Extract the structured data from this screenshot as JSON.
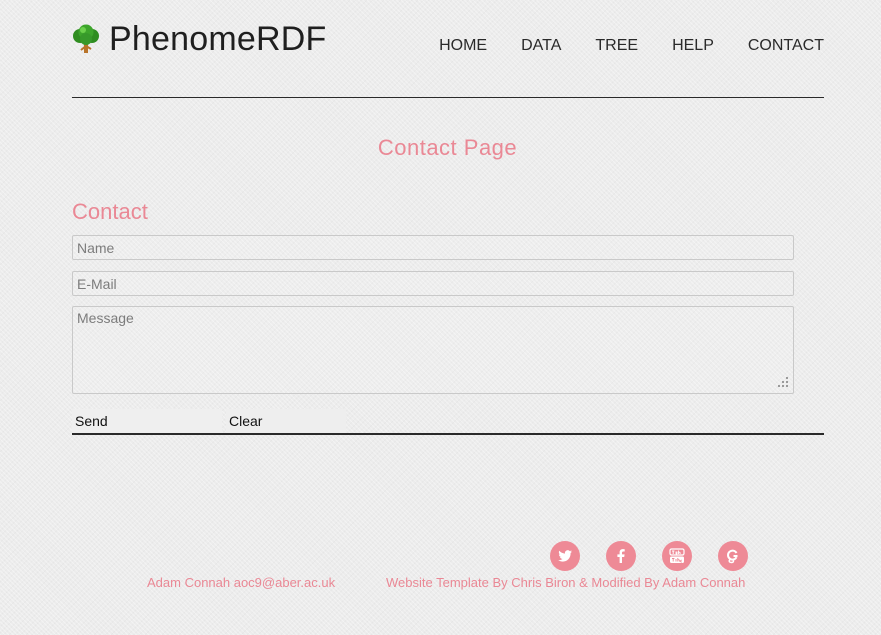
{
  "header": {
    "brand": "PhenomeRDF",
    "logo_icon": "tree-icon",
    "nav": [
      {
        "label": "HOME"
      },
      {
        "label": "DATA"
      },
      {
        "label": "TREE"
      },
      {
        "label": "HELP"
      },
      {
        "label": "CONTACT"
      }
    ]
  },
  "page": {
    "title": "Contact Page"
  },
  "form": {
    "heading": "Contact",
    "name_placeholder": "Name",
    "email_placeholder": "E-Mail",
    "message_placeholder": "Message",
    "send_label": "Send",
    "clear_label": "Clear"
  },
  "footer": {
    "social_icons": [
      "twitter-icon",
      "facebook-icon",
      "youtube-icon",
      "google-plus-icon"
    ],
    "author": "Adam Connah aoc9@aber.ac.uk",
    "credit": "Website Template By Chris Biron & Modified By Adam Connah"
  },
  "colors": {
    "accent": "#ea8895",
    "text": "#222222",
    "background": "#ececec"
  }
}
